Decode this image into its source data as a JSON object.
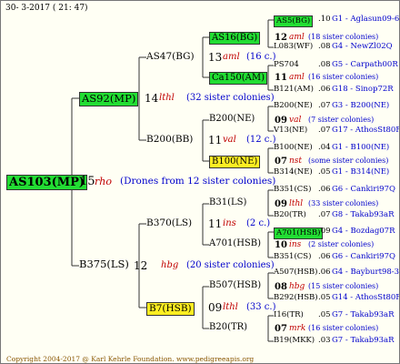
{
  "header": {
    "date": "30-  3-2017 ( 21: 47)"
  },
  "footer": {
    "text": "Copyright 2004-2017 @ Karl Kehrle Foundation.   www.pedigreeapis.org"
  },
  "colors": {
    "green": "#22dd33",
    "yellow": "#ffee22",
    "red": "#c00000",
    "blue": "#0000cc"
  },
  "root": {
    "name": "AS103(MP)",
    "num": "15",
    "code": "rho",
    "note": "(Drones from 12 sister colonies)"
  },
  "gen1": [
    {
      "name": "AS92(MP)",
      "num": "14",
      "code": "lthl",
      "note": "(32 sister colonies)"
    },
    {
      "name": "B375(LS)",
      "num": "12",
      "code": "hbg",
      "note": "(20 sister colonies)"
    }
  ],
  "gen2": [
    {
      "name": "AS47(BG)",
      "num": "13",
      "code": "aml",
      "note": "(16 c.)"
    },
    {
      "name": "B200(BB)",
      "num": "11",
      "code": "val",
      "note": "(12 c.)"
    },
    {
      "name": "B370(LS)",
      "num": "11",
      "code": "ins",
      "note": "(2 c.)"
    },
    {
      "name": "B7(HSB)",
      "num": "09",
      "code": "lthl",
      "note": "(33 c.)"
    }
  ],
  "gen3": [
    {
      "name": "AS16(BG)",
      "num": "12",
      "code": "aml",
      "note": "(18 sister colonies)"
    },
    {
      "name": "Ca150(AM)",
      "num": "11",
      "code": "aml",
      "note": "(16 sister colonies)"
    },
    {
      "name": "B200(NE)",
      "num": "09",
      "code": "val",
      "note": "(7 sister colonies)"
    },
    {
      "name": "B100(NE)",
      "num": "07",
      "code": "nst",
      "note": "(some sister colonies)"
    },
    {
      "name": "B31(LS)",
      "num": "09",
      "code": "lthl",
      "note": "(33 sister colonies)"
    },
    {
      "name": "A701(HSB)",
      "num": "10",
      "code": "ins",
      "note": "(2 sister colonies)"
    },
    {
      "name": "B507(HSB)",
      "num": "08",
      "code": "hbg",
      "note": "(15 sister colonies)"
    },
    {
      "name": "B20(TR)",
      "num": "07",
      "code": "mrk",
      "note": "(16 sister colonies)"
    }
  ],
  "gen4": [
    {
      "name": "AS5(BG)",
      "num": ".10",
      "info": "G1 - Aglasun09-6"
    },
    {
      "name": "L083(WF)",
      "num": ".08",
      "info": "G4 - NewZl02Q"
    },
    {
      "name": "PS704",
      "num": ".08",
      "info": "G5 - Carpath00R"
    },
    {
      "name": "B121(AM)",
      "num": ".06",
      "info": "G18 - Sinop72R"
    },
    {
      "name": "B200(NE)",
      "num": ".07",
      "info": "G3 - B200(NE)"
    },
    {
      "name": "V13(NE)",
      "num": ".07",
      "info": "G17 - AthosSt80R"
    },
    {
      "name": "B100(NE)",
      "num": ".04",
      "info": "G1 - B100(NE)"
    },
    {
      "name": "B314(NE)",
      "num": ".05",
      "info": "G1 - B314(NE)"
    },
    {
      "name": "B351(CS)",
      "num": ".06",
      "info": "G6 - Cankiri97Q"
    },
    {
      "name": "B20(TR)",
      "num": ".07",
      "info": "G8 - Takab93aR"
    },
    {
      "name": "A701(HSB)",
      "num": ".09",
      "info": "G4 - Bozdag07R"
    },
    {
      "name": "B351(CS)",
      "num": ".06",
      "info": "G6 - Cankiri97Q"
    },
    {
      "name": "A507(HSB)",
      "num": ".06",
      "info": "G4 - Bayburt98-3"
    },
    {
      "name": "B292(HSB)",
      "num": ".05",
      "info": "G14 - AthosSt80R"
    },
    {
      "name": "I16(TR)",
      "num": ".05",
      "info": "G7 - Takab93aR"
    },
    {
      "name": "B19(MKK)",
      "num": ".03",
      "info": "G7 - Takab93aR"
    }
  ]
}
